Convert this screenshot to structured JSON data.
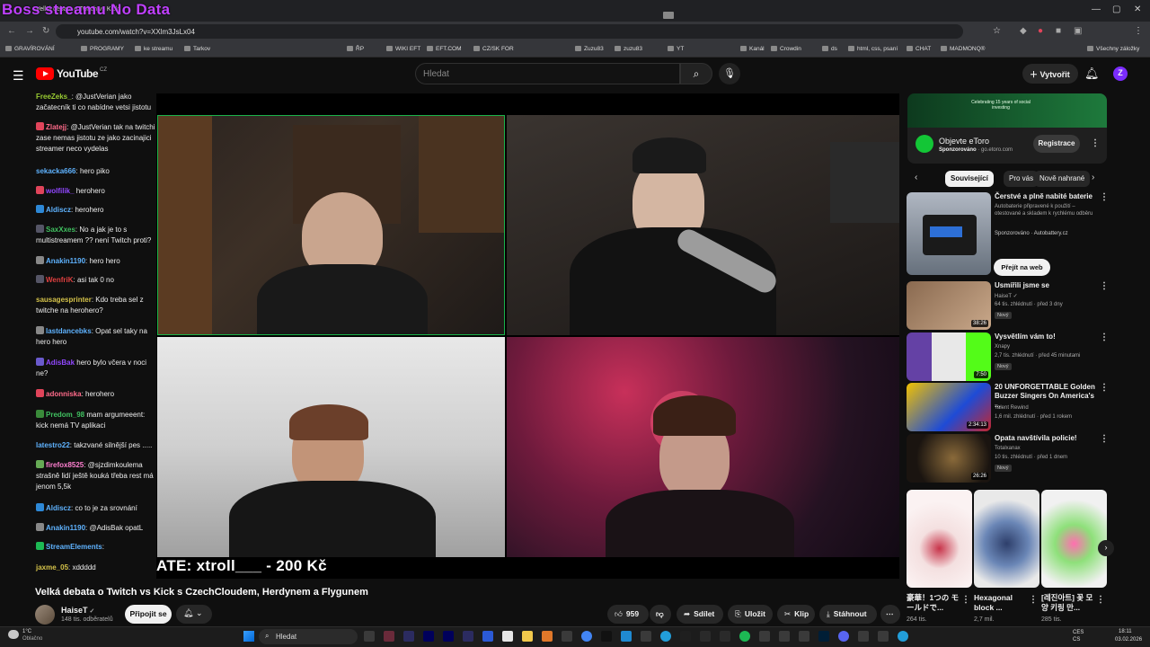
{
  "browser": {
    "overlay_title": "Boss streamu No Data",
    "tab_title": "Velká debata o Twitch vs Kick",
    "url": "youtube.com/watch?v=XXlm3JsLx04",
    "bookmarks": [
      "GRAVÍROVÁNÍ",
      "PROGRAMY",
      "ke streamu",
      "Tarkov",
      "ŘP",
      "WIKI EFT",
      "EFT.COM",
      "CZ/SK FOR",
      "Zuzu83",
      "zuzu83",
      "YT",
      "Kanál",
      "Crowdin",
      "ds",
      "html, css, psaní",
      "CHAT",
      "MADMONQ®",
      "Všechny záložky"
    ]
  },
  "youtube": {
    "logo_text": "YouTube",
    "logo_cc": "CZ",
    "search_placeholder": "Hledat",
    "create_label": "Vytvořit",
    "avatar_letter": "Z"
  },
  "chat": [
    {
      "user": "FreeZeks_",
      "color": "#9acd32",
      "text": ": @JustVerian jako začatecník ti co nabídne vetsi jistotu",
      "badge": ""
    },
    {
      "user": "Zlatejj",
      "color": "#ff6b8a",
      "text": ": @JustVerian tak na twitchi zase nemas jistotu ze jako zacinajici streamer neco vydelas",
      "badge": "#e0445a"
    },
    {
      "user": "sekacka666",
      "color": "#5fb3ff",
      "text": ": hero piko",
      "badge": ""
    },
    {
      "user": "wolfilik_",
      "color": "#9147ff",
      "text": " herohero",
      "badge": "#e0445a"
    },
    {
      "user": "Aldiscz",
      "color": "#5fb3ff",
      "text": ": herohero",
      "badge": "#2d88d6"
    },
    {
      "user": "SaxXxes",
      "color": "#40c060",
      "text": ": No a jak je to s multistreamem ?? není Twitch proti?",
      "badge": "#556"
    },
    {
      "user": "Anakin1190",
      "color": "#5fb3ff",
      "text": ": hero hero",
      "badge": "#888"
    },
    {
      "user": "WenfriK",
      "color": "#e04040",
      "text": ": asi tak 0 no",
      "badge": "#556"
    },
    {
      "user": "sausagesprinter",
      "color": "#d4c24a",
      "text": ": Kdo treba sel z twitche na herohero?",
      "badge": ""
    },
    {
      "user": "lastdancebks",
      "color": "#5fb3ff",
      "text": ": Opat sel taky na hero hero",
      "badge": "#888"
    },
    {
      "user": "AdisBak",
      "color": "#9147ff",
      "text": " hero bylo včera v noci ne?",
      "badge": "#6a5acd"
    },
    {
      "user": "adonniska",
      "color": "#ff6b8a",
      "text": ": herohero",
      "badge": "#e0445a"
    },
    {
      "user": "Predom_98",
      "color": "#40c060",
      "text": " mam argumeeent: kick nemá TV aplikaci",
      "badge": "#3a8a3a"
    },
    {
      "user": "latestro22",
      "color": "#5fb3ff",
      "text": ": takzvané silnější pes .....",
      "badge": ""
    },
    {
      "user": "firefox8525",
      "color": "#ff7fd0",
      "text": ": @sjzdimkoulema strašně lidí ještě kouká třeba rest má jenom 5,5k",
      "badge": "#6a5"
    },
    {
      "user": "Aldiscz",
      "color": "#5fb3ff",
      "text": ": co to je za srovnání",
      "badge": "#2d88d6"
    },
    {
      "user": "Anakin1190",
      "color": "#5fb3ff",
      "text": ": @AdisBak opatL",
      "badge": "#888"
    },
    {
      "user": "StreamElements",
      "color": "#5fb3ff",
      "text": ":",
      "badge": "#1db954"
    },
    {
      "user": "jaxme_05",
      "color": "#d4c24a",
      "text": ": xddddd",
      "badge": ""
    }
  ],
  "video": {
    "donation_text": "ATE: xtroll___ - 200 Kč",
    "title": "Velká debata o Twitch vs Kick s CzechCloudem, Herdynem a Flygunem",
    "channel_name": "HaiseT",
    "channel_subs": "148 tis. odběratelů",
    "join_label": "Připojit se",
    "likes": "959",
    "share_label": "Sdílet",
    "save_label": "Uložit",
    "clip_label": "Klip",
    "download_label": "Stáhnout"
  },
  "right_rail": {
    "ad_banner_text": "Celebrating 15 years of social investing",
    "ad_title": "Objevte eToro",
    "ad_sponsored": "Sponzorováno",
    "ad_domain": "go.etoro.com",
    "register_label": "Registrace",
    "chips": [
      "Související",
      "Pro vás",
      "Nově nahrané"
    ],
    "recs": [
      {
        "title": "Čerstvé a plně nabité baterie",
        "line1": "Autobaterie připravené k použití – otestované a skladem k rychlému odběru",
        "line2": "Sponzorováno · Autobattery.cz",
        "duration": "",
        "badge": ""
      },
      {
        "title": "Usmířili jsme se",
        "line1": "HaiseT ✓",
        "line2": "64 tis. zhlédnutí · před 3 dny",
        "duration": "38:26",
        "badge": "Nový"
      },
      {
        "title": "Vysvětlím vám to!",
        "line1": "Xnapy",
        "line2": "2,7 tis. zhlédnutí · před 45 minutami",
        "duration": "7:50",
        "badge": "Nový"
      },
      {
        "title": "20 UNFORGETTABLE Golden Buzzer Singers On America's ...",
        "line1": "Talent Rewind",
        "line2": "1,6 mil. zhlédnutí · před 1 rokem",
        "duration": "2:34:13",
        "badge": ""
      },
      {
        "title": "Opata navštívila policie!",
        "line1": "Totalxanax",
        "line2": "10 tis. zhlédnutí · před 1 dnem",
        "duration": "26:26",
        "badge": "Nový"
      }
    ],
    "goto_label": "Přejít na web",
    "shorts": [
      {
        "title": "豪華！1つの モールドで...",
        "views": "264 tis."
      },
      {
        "title": "Hexagonal block ...",
        "views": "2,7 mil."
      },
      {
        "title": "[레진아트] 꽃 모양 키링 만...",
        "views": "285 tis."
      }
    ]
  },
  "taskbar": {
    "weather_temp": "1°C",
    "weather_desc": "Oblačno",
    "search_placeholder": "Hledat",
    "lang1": "CES",
    "lang2": "CS",
    "time": "18:11",
    "date": "03.02.2026"
  }
}
